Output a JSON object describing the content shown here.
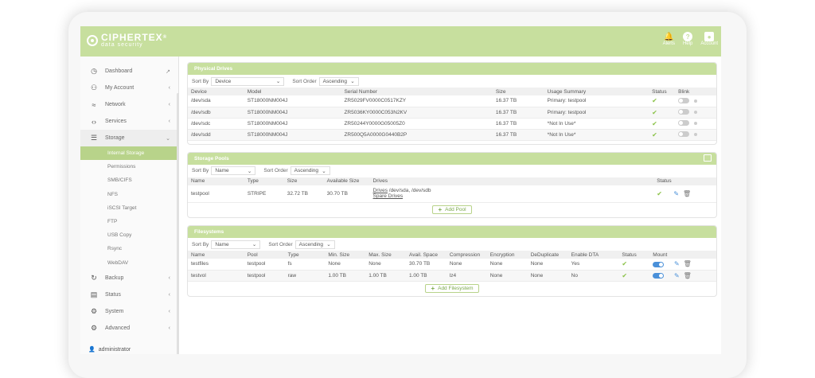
{
  "brand": {
    "name": "CIPHERTEX",
    "mark": "®",
    "tagline": "data security"
  },
  "top_actions": [
    {
      "label": "Alerts"
    },
    {
      "label": "Help"
    },
    {
      "label": "Account"
    }
  ],
  "sidebar": {
    "items": [
      {
        "label": "Dashboard"
      },
      {
        "label": "My Account"
      },
      {
        "label": "Network"
      },
      {
        "label": "Services"
      },
      {
        "label": "Storage"
      }
    ],
    "storage_sub": [
      "Internal Storage",
      "Permissions",
      "SMB/CIFS",
      "NFS",
      "iSCSI Target",
      "FTP",
      "USB Copy",
      "Rsync",
      "WebDAV"
    ],
    "items_after": [
      {
        "label": "Backup"
      },
      {
        "label": "Status"
      },
      {
        "label": "System"
      },
      {
        "label": "Advanced"
      }
    ],
    "user": "administrator"
  },
  "physical_drives": {
    "title": "Physical Drives",
    "sort_by_label": "Sort By",
    "sort_by": "Device",
    "sort_order_label": "Sort Order",
    "sort_order": "Ascending",
    "columns": [
      "Device",
      "Model",
      "Serial Number",
      "Size",
      "Usage Summary",
      "Status",
      "Blink"
    ],
    "rows": [
      [
        "/dev/sda",
        "ST18000NM004J",
        "ZR5029FV0000C0517KZY",
        "16.37 TB",
        "Primary: testpool"
      ],
      [
        "/dev/sdb",
        "ST18000NM004J",
        "ZR5036KY0000C053N2KV",
        "16.37 TB",
        "Primary: testpool"
      ],
      [
        "/dev/sdc",
        "ST18000NM004J",
        "ZR50244Y0000G05005Z0",
        "16.37 TB",
        "*Not In Use*"
      ],
      [
        "/dev/sdd",
        "ST18000NM004J",
        "ZR500Q5A0000G0440B2P",
        "16.37 TB",
        "*Not In Use*"
      ]
    ]
  },
  "storage_pools": {
    "title": "Storage Pools",
    "sort_by_label": "Sort By",
    "sort_by": "Name",
    "sort_order_label": "Sort Order",
    "sort_order": "Ascending",
    "columns": [
      "Name",
      "Type",
      "Size",
      "Available Size",
      "Drives",
      "Status"
    ],
    "rows": [
      {
        "name": "testpool",
        "type": "STRIPE",
        "size": "32.72 TB",
        "available": "30.70 TB",
        "drives_link": "Drives",
        "drives_value": " /dev/sda, /dev/sdb",
        "spare_link": "Spare Drives"
      }
    ],
    "add_label": "Add Pool"
  },
  "filesystems": {
    "title": "Filesystems",
    "sort_by_label": "Sort By",
    "sort_by": "Name",
    "sort_order_label": "Sort Order",
    "sort_order": "Ascending",
    "columns": [
      "Name",
      "Pool",
      "Type",
      "Min. Size",
      "Max. Size",
      "Avail. Space",
      "Compression",
      "Encryption",
      "DeDuplicate",
      "Enable DTA",
      "Status",
      "Mount"
    ],
    "rows": [
      [
        "testfiles",
        "testpool",
        "fs",
        "None",
        "None",
        "30.70 TB",
        "None",
        "None",
        "None",
        "Yes"
      ],
      [
        "testvol",
        "testpool",
        "raw",
        "1.00 TB",
        "1.00 TB",
        "1.00 TB",
        "lz4",
        "None",
        "None",
        "No"
      ]
    ],
    "add_label": "Add Filesystem"
  },
  "colors": {
    "accent": "#c7df9e",
    "active": "#b8d38a",
    "status_ok": "#8cc34a",
    "mount_on": "#4a90d9"
  }
}
